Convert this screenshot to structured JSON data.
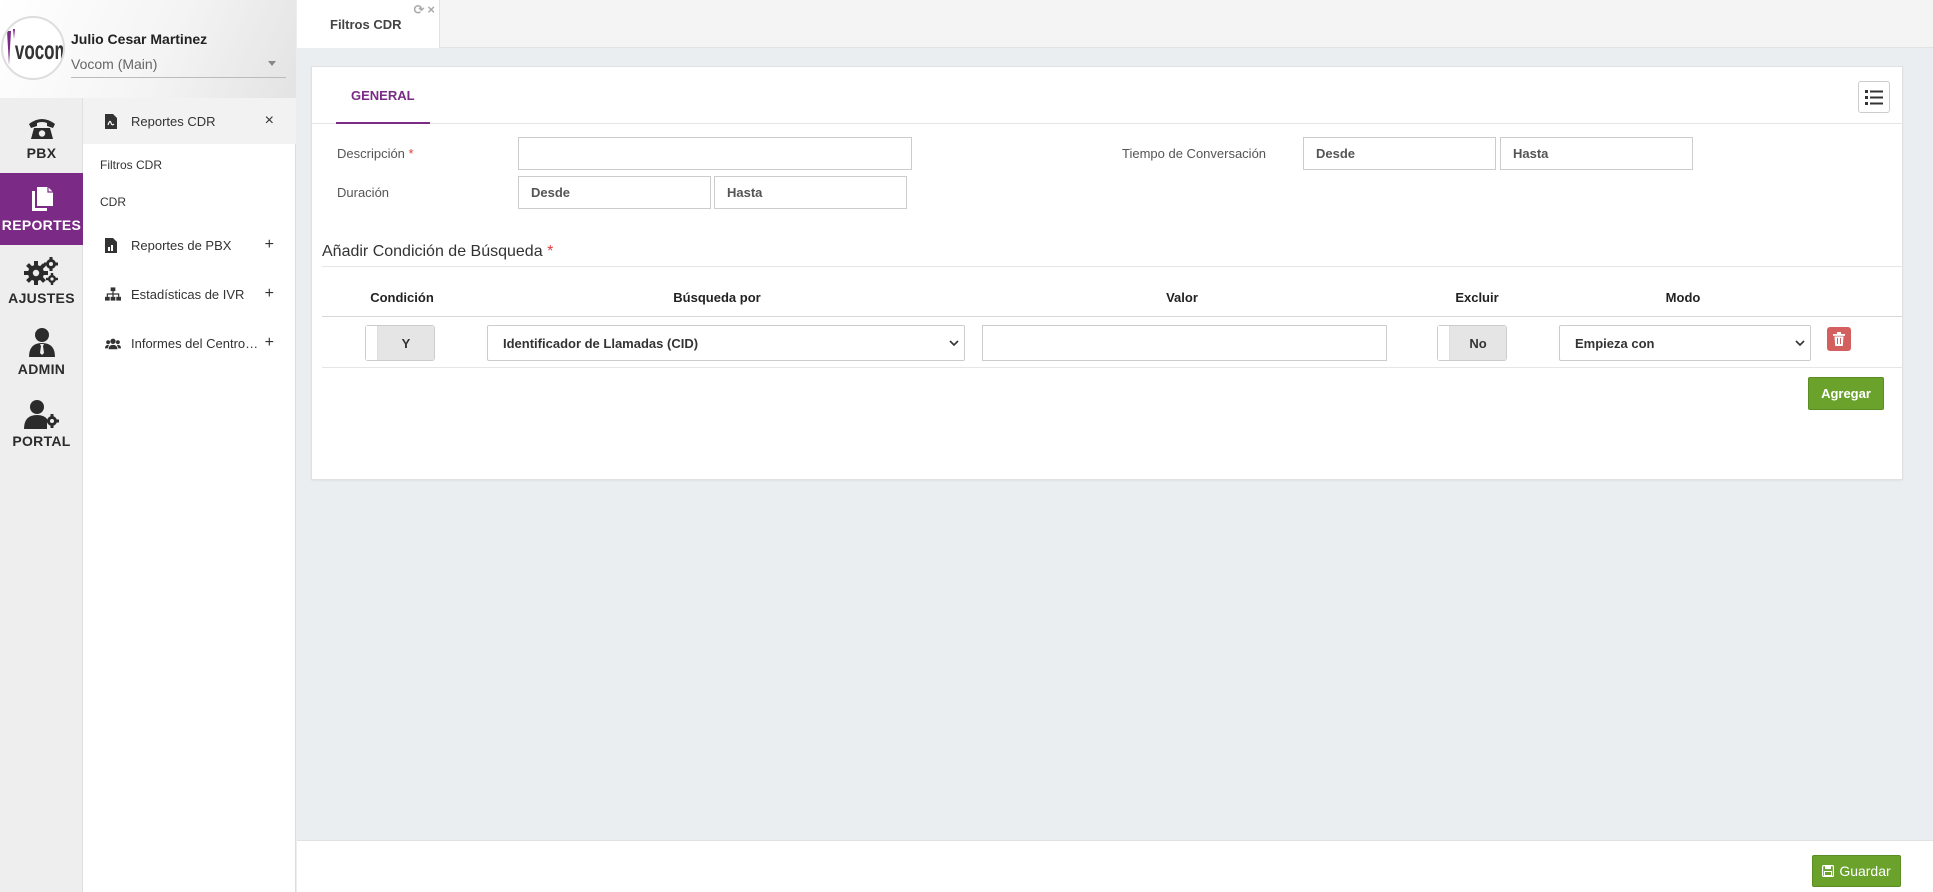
{
  "user": {
    "name": "Julio Cesar Martinez",
    "organization": "Vocom (Main)",
    "logo_text": "vocom"
  },
  "rail": {
    "items": [
      {
        "label": "PBX",
        "icon": "phone-icon"
      },
      {
        "label": "REPORTES",
        "icon": "copy-icon"
      },
      {
        "label": "AJUSTES",
        "icon": "gears-icon"
      },
      {
        "label": "ADMIN",
        "icon": "admin-icon"
      },
      {
        "label": "PORTAL",
        "icon": "user-gear-icon"
      }
    ]
  },
  "sidebar": {
    "sections": [
      {
        "label": "Reportes CDR",
        "action": "×",
        "subitems": [
          "Filtros CDR",
          "CDR"
        ]
      },
      {
        "label": "Reportes de PBX",
        "action": "+"
      },
      {
        "label": "Estadísticas de IVR",
        "action": "+"
      },
      {
        "label": "Informes del Centro de Contacto",
        "action": "+"
      }
    ]
  },
  "tabs": [
    {
      "label": "Filtros CDR",
      "refresh_icon": "⟳",
      "close_icon": "×"
    }
  ],
  "card": {
    "tab_label": "GENERAL",
    "fields": {
      "descripcion_label": "Descripción",
      "required_mark": "*",
      "duracion_label": "Duración",
      "tiempo_label": "Tiempo de Conversación",
      "desde_placeholder": "Desde",
      "hasta_placeholder": "Hasta"
    },
    "search_title": "Añadir Condición de Búsqueda",
    "table": {
      "headers": [
        "Condición",
        "Búsqueda por",
        "Valor",
        "Excluir",
        "Modo"
      ],
      "row": {
        "condicion": "Y",
        "busqueda": "Identificador de Llamadas (CID)",
        "valor": "",
        "excluir": "No",
        "modo": "Empieza con"
      }
    },
    "add_button": "Agregar"
  },
  "footer": {
    "save_button": "Guardar"
  },
  "colors": {
    "brand": "#7b2b86",
    "accent_green": "#6aa22c",
    "danger": "#d45f5f"
  }
}
